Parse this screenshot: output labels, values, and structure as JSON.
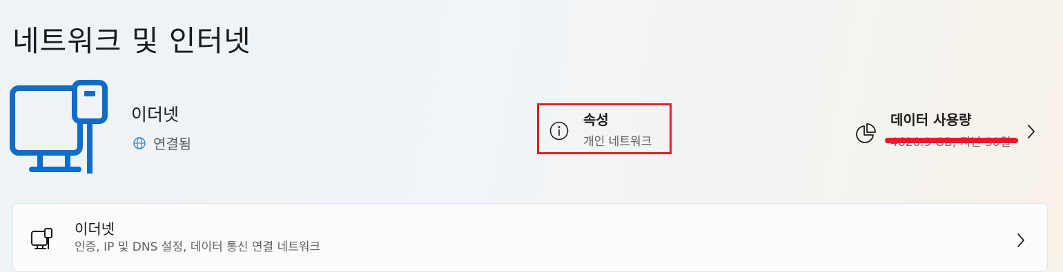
{
  "page": {
    "title": "네트워크 및 인터넷"
  },
  "adapter": {
    "name": "이더넷",
    "status": "연결됨",
    "status_icon": "globe-icon"
  },
  "properties": {
    "title": "속성",
    "subtitle": "개인 네트워크",
    "highlight_color": "#e01c2a"
  },
  "data_usage": {
    "title": "데이터 사용량",
    "subtitle": "4620.9 GB, 지난 30일",
    "redaction_color": "#e01c2a"
  },
  "settings_card": {
    "title": "이더넷",
    "subtitle": "인증, IP 및 DNS 설정, 데이터 통신 연결 네트워크"
  },
  "colors": {
    "accent": "#0a6fd1",
    "text_secondary": "#5f5f5f"
  }
}
